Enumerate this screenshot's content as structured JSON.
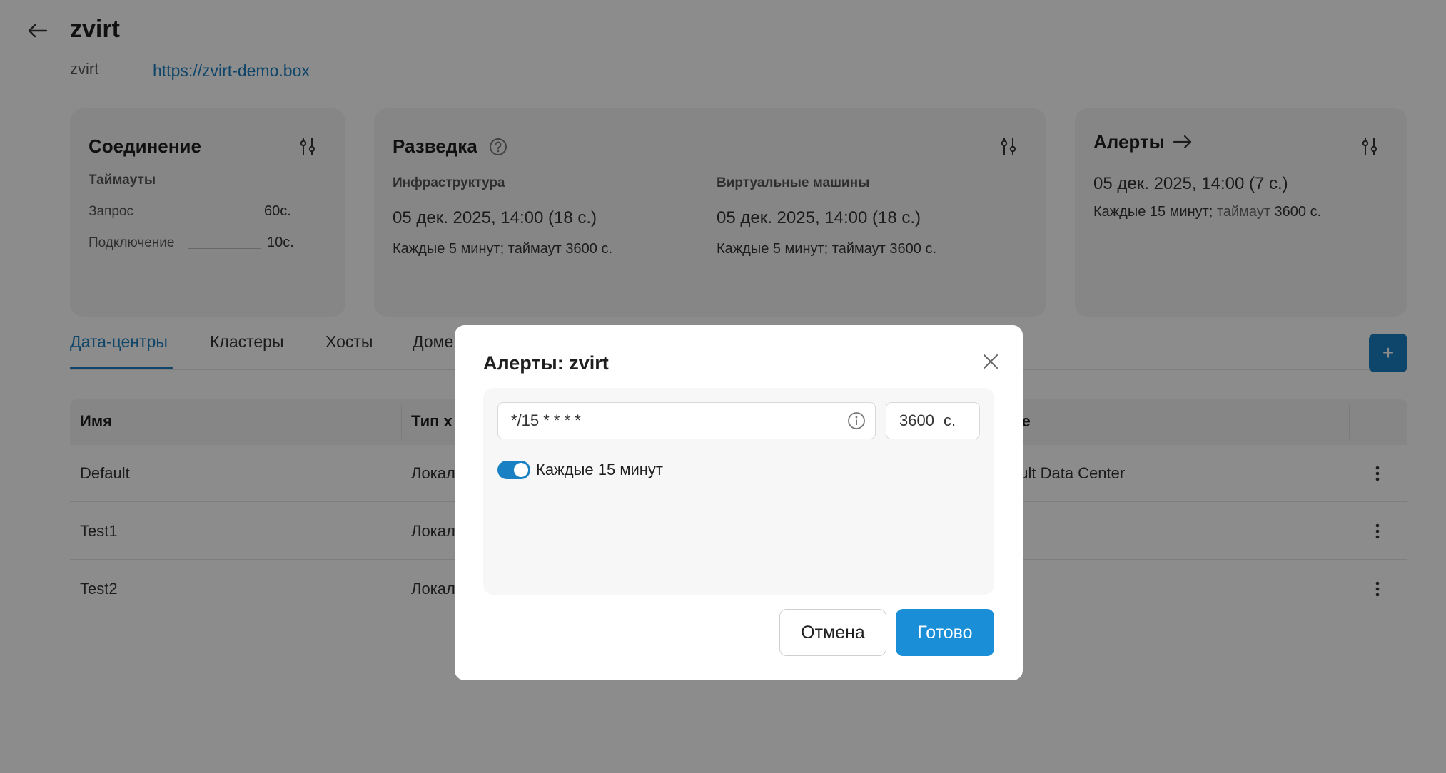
{
  "header": {
    "title": "zvirt",
    "subtitle_name": "zvirt",
    "url": "https://zvirt-demo.box"
  },
  "connection_card": {
    "title": "Соединение",
    "section": "Таймауты",
    "rows": [
      {
        "label": "Запрос",
        "value": "60с."
      },
      {
        "label": "Подключение",
        "value": "10с."
      }
    ]
  },
  "recon_card": {
    "title": "Разведка",
    "columns": [
      {
        "label": "Инфраструктура",
        "date": "05 дек. 2025, 14:00 (18 с.)",
        "schedule": "Каждые 5 минут; таймаут 3600 с."
      },
      {
        "label": "Виртуальные машины",
        "date": "05 дек. 2025, 14:00 (18 с.)",
        "schedule": "Каждые 5 минут; таймаут 3600 с."
      }
    ]
  },
  "alerts_card": {
    "title": "Алерты",
    "date": "05 дек. 2025, 14:00 (7 с.)",
    "schedule_prefix": "Каждые 15 минут;",
    "schedule_mid": "таймаут",
    "schedule_suffix": "3600 с."
  },
  "tabs": [
    {
      "label": "Дата-центры"
    },
    {
      "label": "Кластеры"
    },
    {
      "label": "Хосты"
    },
    {
      "label": "Доме"
    }
  ],
  "add_button": "+",
  "table": {
    "headers": [
      "Имя",
      "Тип х",
      "ие"
    ],
    "rows": [
      {
        "name": "Default",
        "type": "Локал",
        "desc": "ault Data Center"
      },
      {
        "name": "Test1",
        "type": "Локал",
        "desc": ""
      },
      {
        "name": "Test2",
        "type": "Локал",
        "desc": ""
      }
    ]
  },
  "modal": {
    "title": "Алерты: zvirt",
    "cron_value": "*/15 * * * *",
    "timeout_value": "3600",
    "timeout_unit": "с.",
    "toggle_label": "Каждые 15 минут",
    "cancel_label": "Отмена",
    "ok_label": "Готово"
  },
  "colors": {
    "accent": "#1a80c4",
    "link": "#1a7fbf",
    "overlay": "rgba(0,0,0,0.45)"
  }
}
